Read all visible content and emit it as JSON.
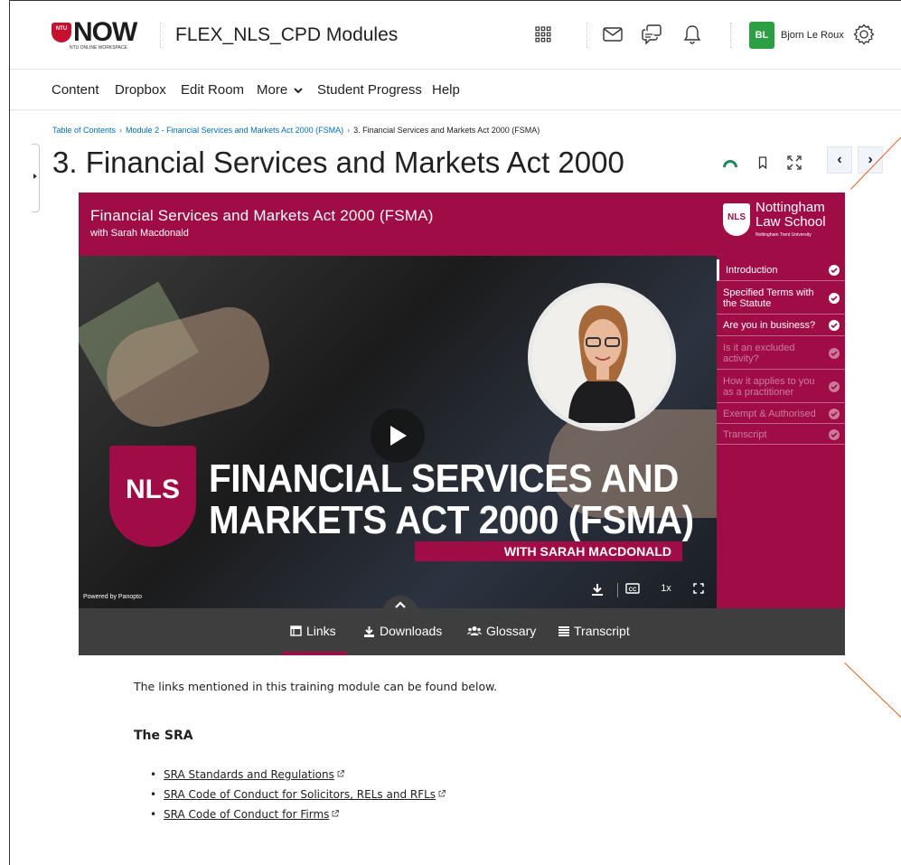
{
  "header": {
    "logo_text": "NOW",
    "logo_badge": "NTU",
    "logo_subtitle": "NTU ONLINE WORKSPACE",
    "course_title": "FLEX_NLS_CPD Modules",
    "user_initials": "BL",
    "user_name": "Bjorn Le Roux",
    "avatar_color": "#2c9f45",
    "icons": [
      "apps-grid-icon",
      "email-icon",
      "chat-icon",
      "bell-icon",
      "gear-icon"
    ]
  },
  "nav": {
    "items": [
      "Content",
      "Dropbox",
      "Edit Room",
      "More",
      "Student Progress",
      "Help"
    ]
  },
  "breadcrumb": {
    "items": [
      "Table of Contents",
      "Module 2 - Financial Services and Markets Act 2000 (FSMA)",
      "3. Financial Services and Markets Act 2000 (FSMA)"
    ]
  },
  "page": {
    "title": "3. Financial Services and Markets Act 2000",
    "title_icons": [
      "progress-icon",
      "bookmark-icon",
      "fullscreen-icon"
    ],
    "prev_label": "‹",
    "next_label": "›"
  },
  "player": {
    "brand_color": "#a00d46",
    "title": "Financial Services and Markets Act 2000 (FSMA)",
    "subtitle": "with Sarah Macdonald",
    "logo_badge": "NLS",
    "logo_name_line1": "Nottingham",
    "logo_name_line2": "Law School",
    "logo_university": "Nottingham Trent University",
    "video_badge": "NLS",
    "video_headline_line1": "FINANCIAL SERVICES AND",
    "video_headline_line2": "MARKETS ACT 2000 (FSMA)",
    "video_band": "WITH SARAH MACDONALD",
    "powered_by": "Powered by Panopto",
    "speed": "1x",
    "chapters": [
      {
        "label": "Introduction",
        "done": true,
        "active": true
      },
      {
        "label": "Specified Terms with the Statute",
        "done": true,
        "active": false
      },
      {
        "label": "Are you in business?",
        "done": true,
        "active": false
      },
      {
        "label": "Is it an excluded activity?",
        "done": false,
        "active": false
      },
      {
        "label": "How it applies to you as a practitioner",
        "done": false,
        "active": false
      },
      {
        "label": "Exempt & Authorised",
        "done": false,
        "active": false
      },
      {
        "label": "Transcript",
        "done": false,
        "active": false
      }
    ],
    "tabs": [
      "Links",
      "Downloads",
      "Glossary",
      "Transcript"
    ],
    "active_tab": "Links"
  },
  "content": {
    "intro": "The links mentioned in this training module can be found below.",
    "section_heading": "The SRA",
    "links": [
      "SRA Standards and Regulations",
      "SRA Code of Conduct for Solicitors, RELs and RFLs",
      "SRA Code of Conduct for Firms"
    ]
  }
}
